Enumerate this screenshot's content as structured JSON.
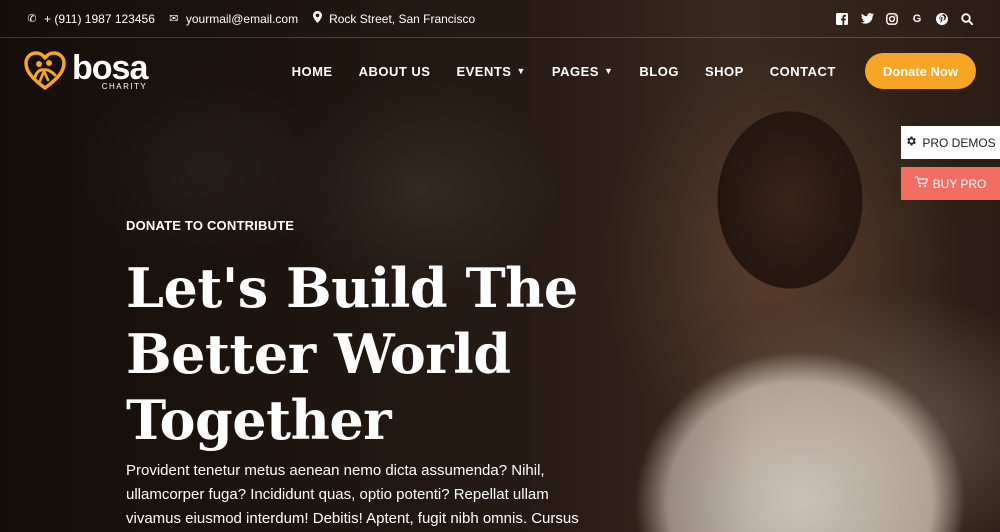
{
  "topbar": {
    "phone": "+ (911) 1987 123456",
    "email": "yourmail@email.com",
    "address": "Rock Street, San Francisco",
    "socials": [
      "facebook-icon",
      "twitter-icon",
      "instagram-icon",
      "google-icon",
      "pinterest-icon",
      "search-icon"
    ]
  },
  "logo": {
    "name": "bosa",
    "tagline": "CHARITY"
  },
  "nav": {
    "items": [
      "HOME",
      "ABOUT US",
      "EVENTS",
      "PAGES",
      "BLOG",
      "SHOP",
      "CONTACT"
    ],
    "donate_label": "Donate Now"
  },
  "side": {
    "pro_demos": "PRO DEMOS",
    "buy_pro": "BUY PRO"
  },
  "hero": {
    "eyebrow": "DONATE TO CONTRIBUTE",
    "title_line1": "Let's Build The",
    "title_line2": "Better World",
    "title_line3": "Together",
    "text": "Provident tenetur metus aenean nemo dicta assumenda? Nihil, ullamcorper fuga? Incididunt quas, optio potenti? Repellat ullam vivamus eiusmod interdum! Debitis! Aptent, fugit nibh omnis. Cursus"
  },
  "colors": {
    "accent": "#f6a624",
    "buy_pro": "#f26d62"
  }
}
